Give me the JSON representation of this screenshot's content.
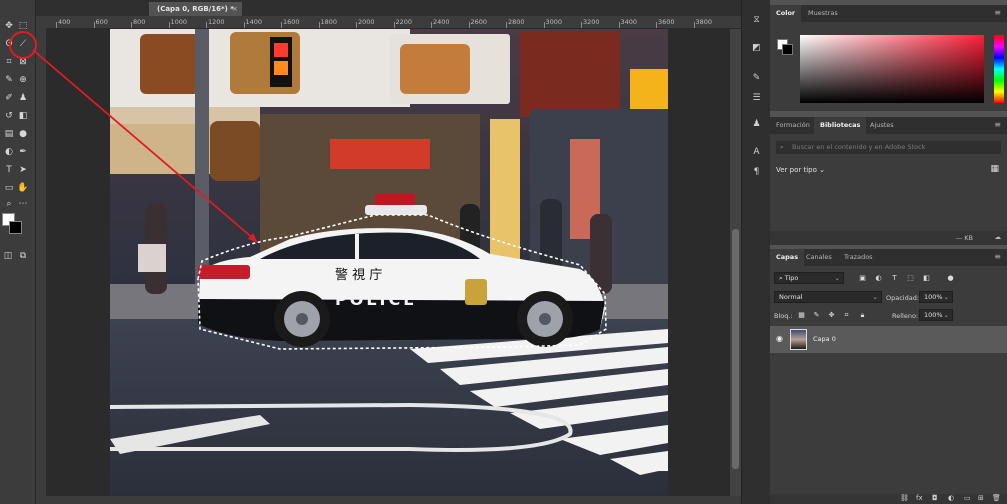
{
  "document": {
    "tab_title": "(Capa 0, RGB/16*) *",
    "close": "×"
  },
  "ruler": {
    "ticks": [
      "400",
      "600",
      "800",
      "1000",
      "1200",
      "1400",
      "1600",
      "1800",
      "2000",
      "2200",
      "2400",
      "2600",
      "2800",
      "3000",
      "3200",
      "3400",
      "3600",
      "3800"
    ]
  },
  "color_panel": {
    "tabs": [
      "Color",
      "Muestras"
    ],
    "active_tab": "Color"
  },
  "libraries_panel": {
    "tabs": [
      "Formación",
      "Bibliotecas",
      "Ajustes"
    ],
    "active_tab": "Bibliotecas",
    "search_placeholder": "Buscar en el contenido y en Adobe Stock",
    "view_label": "Ver por tipo",
    "footer_size": "— KB"
  },
  "layers_panel": {
    "tabs": [
      "Capas",
      "Canales",
      "Trazados"
    ],
    "active_tab": "Capas",
    "filter_kind": "Tipo",
    "blend_mode": "Normal",
    "opacity_label": "Opacidad:",
    "opacity_value": "100%",
    "lock_label": "Bloq.:",
    "fill_label": "Relleno:",
    "fill_value": "100%",
    "layer_name": "Capa 0"
  },
  "photo": {
    "police_text": "POLICE",
    "kanji": "警 視 庁"
  },
  "icons": {
    "highlighted_tool": "quick-selection-brush-icon",
    "annotation_color": "#e01b24"
  },
  "colors": {
    "color_field_hue": "#ff1f38"
  }
}
